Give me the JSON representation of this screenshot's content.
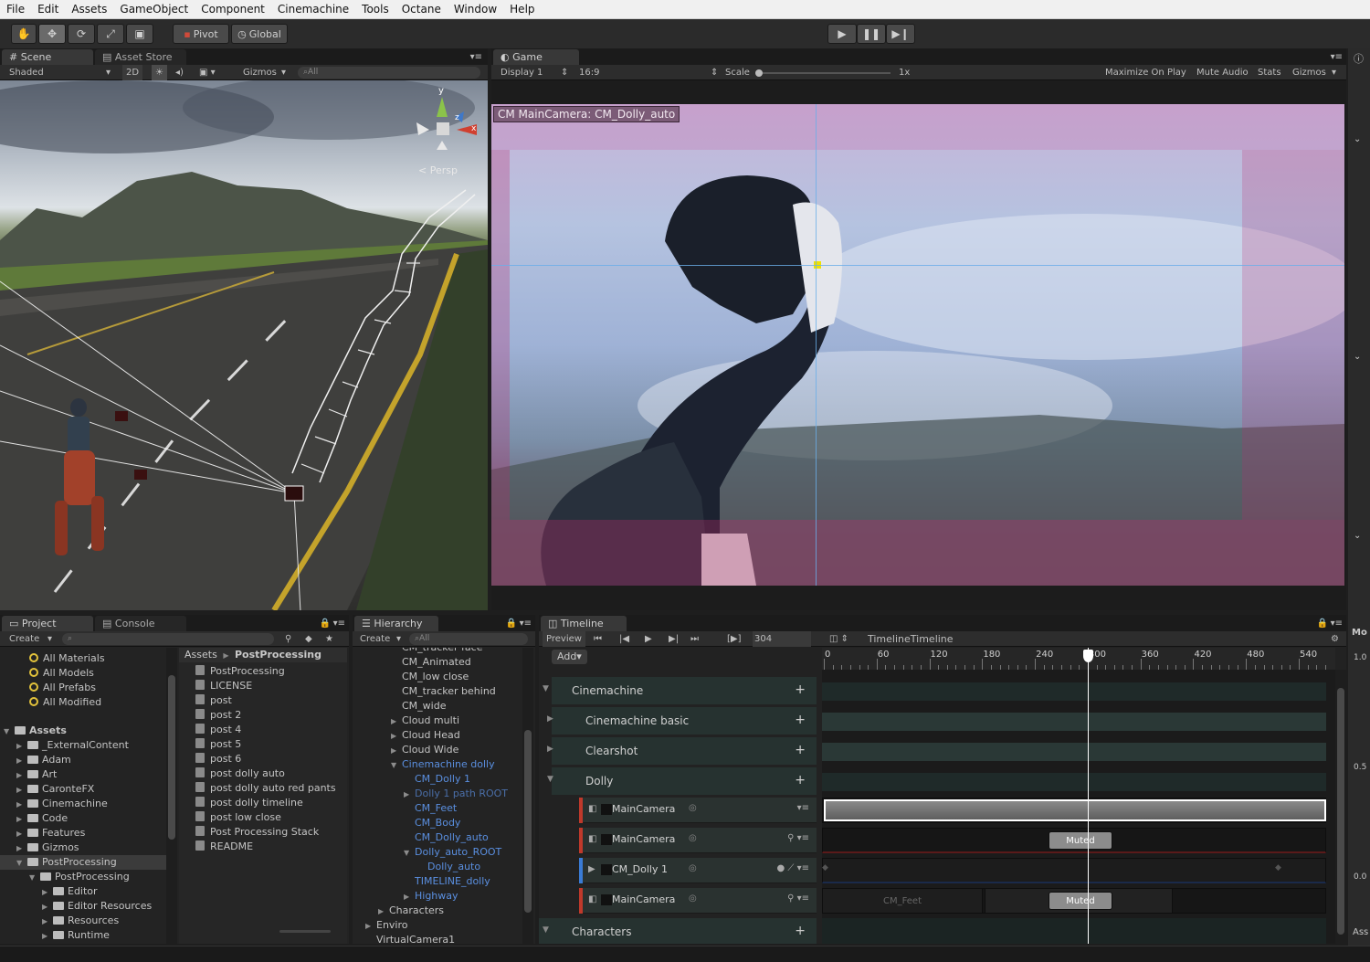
{
  "menu": [
    "File",
    "Edit",
    "Assets",
    "GameObject",
    "Component",
    "Cinemachine",
    "Tools",
    "Octane",
    "Window",
    "Help"
  ],
  "toolbar": {
    "pivot": "Pivot",
    "global": "Global",
    "hand_icon": "hand-icon",
    "move_icon": "move-icon",
    "rotate_icon": "rotate-icon",
    "scale_icon": "scale-icon",
    "rect_icon": "rect-icon"
  },
  "scene": {
    "tabs": [
      "Scene",
      "Asset Store"
    ],
    "shading": "Shaded",
    "mode_2d": "2D",
    "gizmos": "Gizmos",
    "search": "All",
    "persp": "Persp",
    "axis_y": "y",
    "axis_z": "z",
    "axis_x": "x"
  },
  "game": {
    "tab": "Game",
    "display": "Display 1",
    "aspect": "16:9",
    "scale_label": "Scale",
    "scale_value": "1x",
    "maximize": "Maximize On Play",
    "mute": "Mute Audio",
    "stats": "Stats",
    "gizmos": "Gizmos",
    "camera_label": "CM MainCamera: CM_Dolly_auto"
  },
  "project": {
    "tabs": [
      "Project",
      "Console"
    ],
    "create": "Create",
    "favorites": [
      "All Materials",
      "All Models",
      "All Prefabs",
      "All Modified"
    ],
    "assets_root": "Assets",
    "asset_folders": [
      "_ExternalContent",
      "Adam",
      "Art",
      "CaronteFX",
      "Cinemachine",
      "Code",
      "Features",
      "Gizmos",
      "PostProcessing"
    ],
    "sub_folder": "PostProcessing",
    "sub_children": [
      "Editor",
      "Editor Resources",
      "Resources",
      "Runtime"
    ],
    "breadcrumb_root": "Assets",
    "breadcrumb_current": "PostProcessing",
    "files": [
      "PostProcessing",
      "LICENSE",
      "post",
      "post 2",
      "post 4",
      "post 5",
      "post 6",
      "post dolly auto",
      "post dolly auto red pants",
      "post dolly timeline",
      "post low close",
      "Post Processing Stack",
      "README"
    ]
  },
  "hierarchy": {
    "tab": "Hierarchy",
    "create": "Create",
    "search": "All",
    "items": [
      {
        "label": "CM_tracker face",
        "indent": 0,
        "arrow": "",
        "color": "normal"
      },
      {
        "label": "CM_Animated",
        "indent": 0,
        "arrow": "",
        "color": "normal"
      },
      {
        "label": "CM_low close",
        "indent": 0,
        "arrow": "",
        "color": "normal"
      },
      {
        "label": "CM_tracker behind",
        "indent": 0,
        "arrow": "",
        "color": "normal"
      },
      {
        "label": "CM_wide",
        "indent": 0,
        "arrow": "",
        "color": "normal"
      },
      {
        "label": "Cloud multi",
        "indent": 0,
        "arrow": "▶",
        "color": "normal"
      },
      {
        "label": "Cloud Head",
        "indent": 0,
        "arrow": "▶",
        "color": "normal"
      },
      {
        "label": "Cloud Wide",
        "indent": 0,
        "arrow": "▶",
        "color": "normal"
      },
      {
        "label": "Cinemachine dolly",
        "indent": 0,
        "arrow": "▼",
        "color": "blue"
      },
      {
        "label": "CM_Dolly 1",
        "indent": 1,
        "arrow": "",
        "color": "blue"
      },
      {
        "label": "Dolly 1 path ROOT",
        "indent": 1,
        "arrow": "▶",
        "color": "dimblue"
      },
      {
        "label": "CM_Feet",
        "indent": 1,
        "arrow": "",
        "color": "blue"
      },
      {
        "label": "CM_Body",
        "indent": 1,
        "arrow": "",
        "color": "blue"
      },
      {
        "label": "CM_Dolly_auto",
        "indent": 1,
        "arrow": "",
        "color": "blue"
      },
      {
        "label": "Dolly_auto_ROOT",
        "indent": 1,
        "arrow": "▼",
        "color": "blue"
      },
      {
        "label": "Dolly_auto",
        "indent": 2,
        "arrow": "",
        "color": "blue"
      },
      {
        "label": "TIMELINE_dolly",
        "indent": 1,
        "arrow": "",
        "color": "blue"
      },
      {
        "label": "Highway",
        "indent": 1,
        "arrow": "▶",
        "color": "blue"
      },
      {
        "label": "Characters",
        "indent": -1,
        "arrow": "▶",
        "color": "normal"
      },
      {
        "label": "Enviro",
        "indent": -2,
        "arrow": "▶",
        "color": "normal"
      },
      {
        "label": "VirtualCamera1",
        "indent": -2,
        "arrow": "",
        "color": "normal"
      }
    ]
  },
  "timeline": {
    "tab": "Timeline",
    "preview": "Preview",
    "frame": "304",
    "asset_name": "TimelineTimeline",
    "add": "Add",
    "ruler": [
      "0",
      "60",
      "120",
      "180",
      "240",
      "300",
      "360",
      "420",
      "480",
      "540"
    ],
    "playhead_frame": 300,
    "groups": [
      {
        "label": "Cinemachine",
        "level": 0
      },
      {
        "label": "Cinemachine basic",
        "level": 1
      },
      {
        "label": "Clearshot",
        "level": 1
      },
      {
        "label": "Dolly",
        "level": 1
      }
    ],
    "tracks": [
      {
        "label": "MainCamera",
        "color": "#c0392b"
      },
      {
        "label": "MainCamera",
        "color": "#c0392b"
      },
      {
        "label": "CM_Dolly 1",
        "color": "#3a7bd5"
      },
      {
        "label": "MainCamera",
        "color": "#c0392b"
      }
    ],
    "footer_group": "Characters",
    "muted": "Muted",
    "clip_feet": "CM_Feet",
    "plus": "+"
  },
  "inspector": {
    "label": "Mo",
    "values": [
      "1.0",
      "0.5",
      "0.0"
    ],
    "footer": "Ass"
  }
}
